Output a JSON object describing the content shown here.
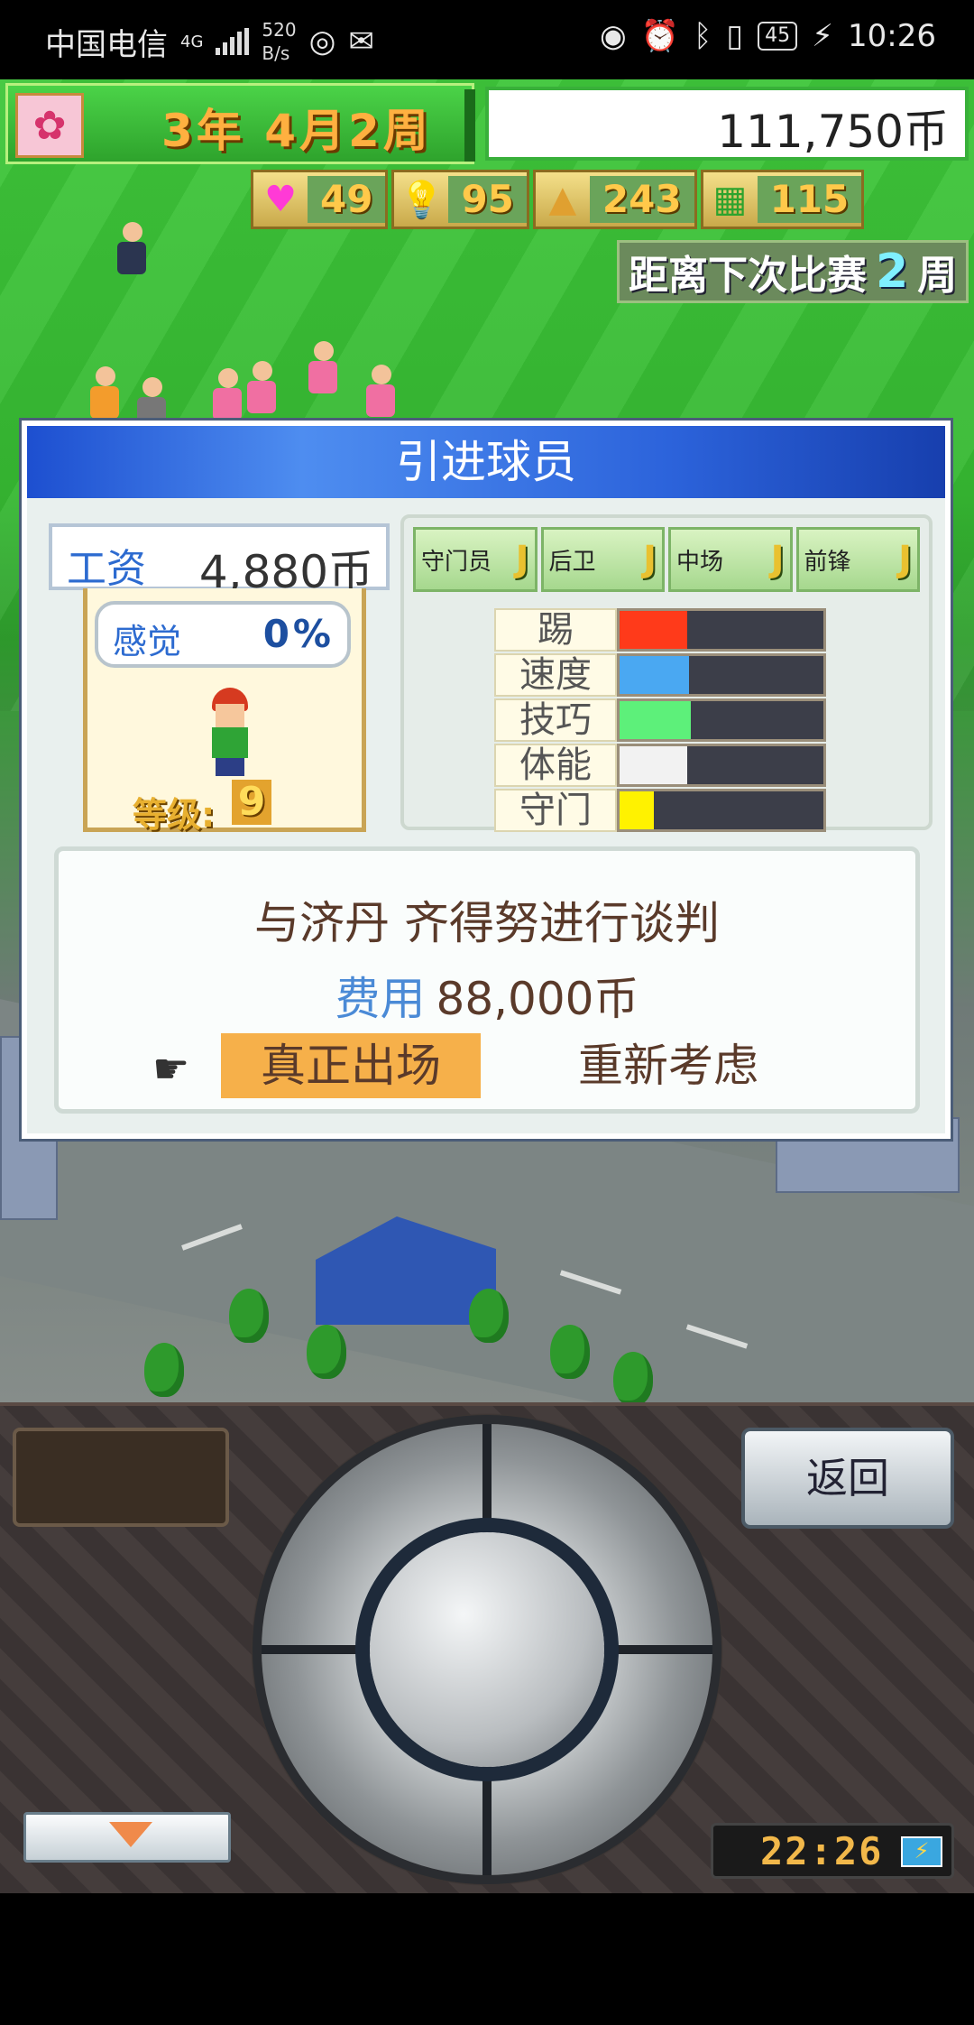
{
  "status_bar": {
    "carrier": "中国电信",
    "network": "4G",
    "speed_value": "520",
    "speed_unit": "B/s",
    "battery": "45",
    "time": "10:26"
  },
  "hud": {
    "date": "3年 4月2周",
    "money": "111,750币",
    "stats": [
      {
        "icon": "heart-icon",
        "value": "49"
      },
      {
        "icon": "lightbulb-icon",
        "value": "95"
      },
      {
        "icon": "poop-icon",
        "value": "243"
      },
      {
        "icon": "field-icon",
        "value": "115"
      }
    ],
    "next_match_label": "距离下次比赛",
    "next_match_weeks": "2",
    "next_match_unit": "周"
  },
  "dialog": {
    "title": "引进球员",
    "salary_label": "工资",
    "salary_value": "4,880币",
    "feeling_label": "感觉",
    "feeling_value": "0%",
    "level_label": "等级:",
    "level_value": "9",
    "positions": [
      {
        "label": "守门员",
        "grade": "J"
      },
      {
        "label": "后卫",
        "grade": "J"
      },
      {
        "label": "中场",
        "grade": "J"
      },
      {
        "label": "前锋",
        "grade": "J"
      }
    ],
    "attributes": [
      {
        "label": "踢",
        "value": 0.33,
        "color": "#ff3a1a"
      },
      {
        "label": "速度",
        "value": 0.34,
        "color": "#4aa8f2"
      },
      {
        "label": "技巧",
        "value": 0.35,
        "color": "#5df07a"
      },
      {
        "label": "体能",
        "value": 0.33,
        "color": "#f2f2f2"
      },
      {
        "label": "守门",
        "value": 0.17,
        "color": "#fff200"
      }
    ],
    "negotiation_text": "与济丹 齐得努进行谈判",
    "cost_label": "费用",
    "cost_value": "88,000币",
    "option_confirm": "真正出场",
    "option_reconsider": "重新考虑"
  },
  "controller": {
    "back_label": "返回",
    "clock": "22:26"
  }
}
